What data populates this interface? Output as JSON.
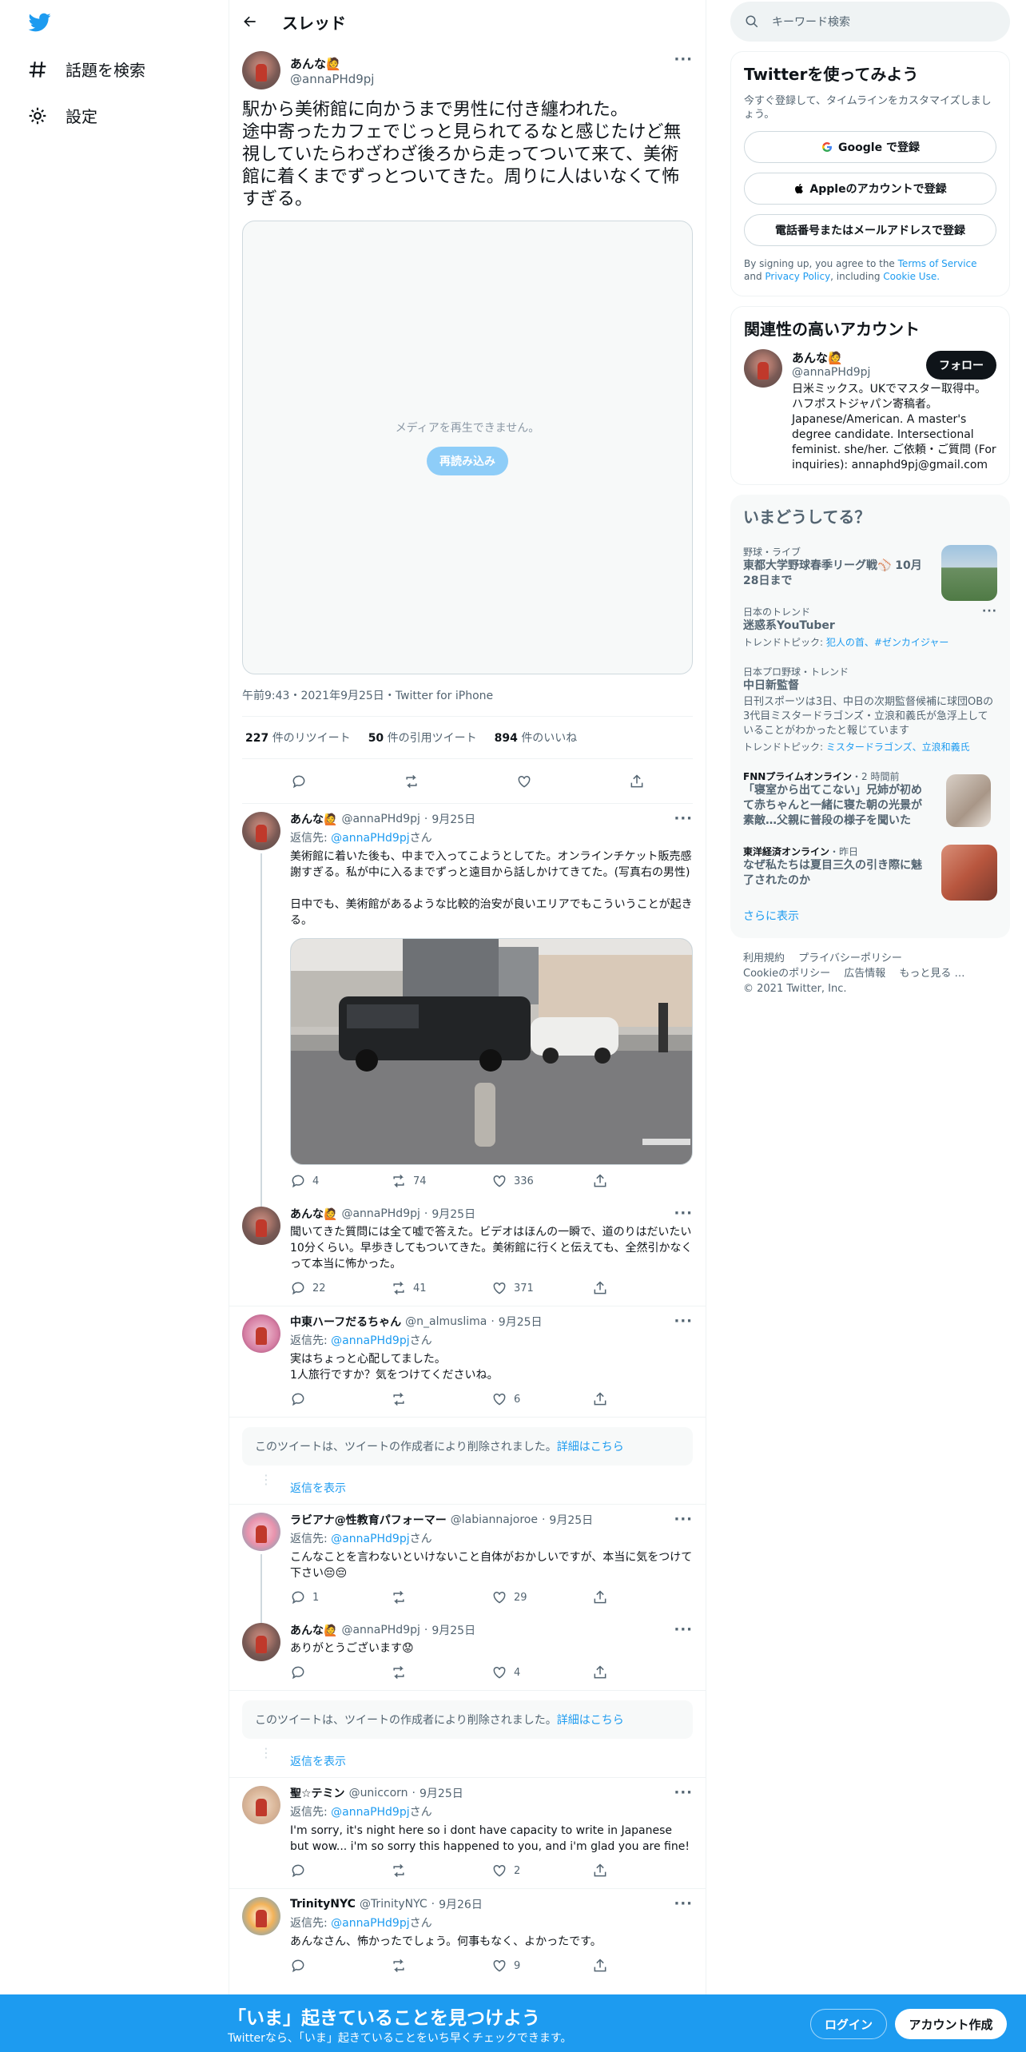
{
  "nav": {
    "explore": "話題を検索",
    "settings": "設定"
  },
  "header": {
    "title": "スレッド"
  },
  "focal": {
    "name": "あんな🙋",
    "handle": "@annaPHd9pj",
    "text": "駅から美術館に向かうまで男性に付き纏われた。\n途中寄ったカフェでじっと見られてるなと感じたけど無視していたらわざわざ後ろから走ってついて来て、美術館に着くまでずっとついてきた。周りに人はいなくて怖すぎる。",
    "media_error": "メディアを再生できません。",
    "reload": "再読み込み",
    "meta": "午前9:43・2021年9月25日・Twitter for iPhone",
    "retweets": "227",
    "retweets_label": "件のリツイート",
    "quotes": "50",
    "quotes_label": "件の引用ツイート",
    "likes": "894",
    "likes_label": "件のいいね"
  },
  "replies": [
    {
      "name": "あんな🙋",
      "handle": "@annaPHd9pj",
      "date": "9月25日",
      "reply_to": "@annaPHd9pj",
      "text": "美術館に着いた後も、中まで入ってこようとしてた。オンラインチケット販売感謝すぎる。私が中に入るまでずっと遠目から話しかけてきてた。(写真右の男性)\n\n日中でも、美術館があるような比較的治安が良いエリアでもこういうことが起きる。",
      "replies": "4",
      "retweets": "74",
      "likes": "336"
    },
    {
      "name": "あんな🙋",
      "handle": "@annaPHd9pj",
      "date": "9月25日",
      "text": "聞いてきた質問には全て嘘で答えた。ビデオはほんの一瞬で、道のりはだいたい10分くらい。早歩きしてもついてきた。美術館に行くと伝えても、全然引かなくって本当に怖かった。",
      "replies": "22",
      "retweets": "41",
      "likes": "371"
    },
    {
      "name": "中東ハーフだるちゃん",
      "handle": "@n_almuslima",
      "date": "9月25日",
      "reply_to": "@annaPHd9pj",
      "text": "実はちょっと心配してました。\n1人旅行ですか？気をつけてくださいね。",
      "replies": "",
      "retweets": "",
      "likes": "6"
    },
    {
      "name": "ラビアナ@性教育パフォーマー",
      "handle": "@labiannajoroe",
      "date": "9月25日",
      "reply_to": "@annaPHd9pj",
      "text": "こんなことを言わないといけないこと自体がおかしいですが、本当に気をつけて下さい😔😔",
      "replies": "1",
      "retweets": "",
      "likes": "29"
    },
    {
      "name": "あんな🙋",
      "handle": "@annaPHd9pj",
      "date": "9月25日",
      "text": "ありがとうございます😟",
      "replies": "",
      "retweets": "",
      "likes": "4"
    },
    {
      "name": "聖☆テミン",
      "handle": "@uniccorn",
      "date": "9月25日",
      "reply_to": "@annaPHd9pj",
      "text": "I'm sorry, it's night here so i dont have capacity to write in Japanese but wow... i'm so sorry this happened to you, and i'm glad you are fine!",
      "replies": "",
      "retweets": "",
      "likes": "2"
    },
    {
      "name": "TrinityNYC",
      "handle": "@TrinityNYC",
      "date": "9月26日",
      "reply_to": "@annaPHd9pj",
      "text": "あんなさん、怖かったでしょう。何事もなく、よかったです。",
      "replies": "",
      "retweets": "",
      "likes": "9"
    }
  ],
  "reply_suffix": "さん",
  "reply_prefix": "返信先: ",
  "deleted": {
    "text": "このツイートは、ツイートの作成者により削除されました。",
    "link": "詳細はこちら",
    "show_replies": "返信を表示"
  },
  "search": {
    "placeholder": "キーワード検索"
  },
  "signup": {
    "title": "Twitterを使ってみよう",
    "sub": "今すぐ登録して、タイムラインをカスタマイズしましょう。",
    "google": "Google で登録",
    "apple": "Appleのアカウントで登録",
    "phone": "電話番号またはメールアドレスで登録",
    "terms_a": "By signing up, you agree to the ",
    "terms_tos": "Terms of Service",
    "terms_and": " and ",
    "terms_privacy": "Privacy Policy",
    "terms_incl": ", including ",
    "terms_cookie": "Cookie Use."
  },
  "related": {
    "title": "関連性の高いアカウント",
    "name": "あんな🙋",
    "handle": "@annaPHd9pj",
    "follow": "フォロー",
    "bio": "日米ミックス。UKでマスター取得中。ハフポストジャパン寄稿者。Japanese/American. A master's degree candidate. Intersectional feminist. she/her. ご依頼・ご質問 (For inquiries): annaphd9pj@gmail.com"
  },
  "trends": {
    "title": "いまどうしてる？",
    "items": [
      {
        "cat": "野球・ライブ",
        "title": "東都大学野球春季リーグ戦⚾ 10月28日まで"
      },
      {
        "cat": "日本のトレンド",
        "title": "迷惑系YouTuber",
        "topics_label": "トレンドトピック: ",
        "topics": "犯人の首、#ゼンカイジャー"
      },
      {
        "cat": "日本プロ野球・トレンド",
        "title": "中日新監督",
        "desc": "日刊スポーツは3日、中日の次期監督候補に球団OBの3代目ミスタードラゴンズ・立浪和義氏が急浮上していることがわかったと報じています",
        "topics_label": "トレンドトピック: ",
        "topics": "ミスタードラゴンズ、立浪和義氏"
      },
      {
        "cat": "FNNプライムオンライン",
        "meta": "・2 時間前",
        "title": "「寝室から出てこない」兄姉が初めて赤ちゃんと一緒に寝た朝の光景が素敵…父親に普段の様子を聞いた"
      },
      {
        "cat": "東洋経済オンライン",
        "meta": "・昨日",
        "title": "なぜ私たちは夏目三久の引き際に魅了されたのか"
      }
    ],
    "more": "さらに表示"
  },
  "footer": {
    "terms": "利用規約",
    "privacy": "プライバシーポリシー",
    "cookie": "Cookieのポリシー",
    "ads": "広告情報",
    "more": "もっと見る …",
    "copyright": "© 2021 Twitter, Inc."
  },
  "bottombar": {
    "headline": "「いま」起きていることを見つけよう",
    "sub": "Twitterなら、「いま」起きていることをいち早くチェックできます。",
    "login": "ログイン",
    "signup": "アカウント作成"
  },
  "colors": {
    "accent": "#1d9bf0",
    "text": "#0f1419",
    "muted": "#536471"
  }
}
